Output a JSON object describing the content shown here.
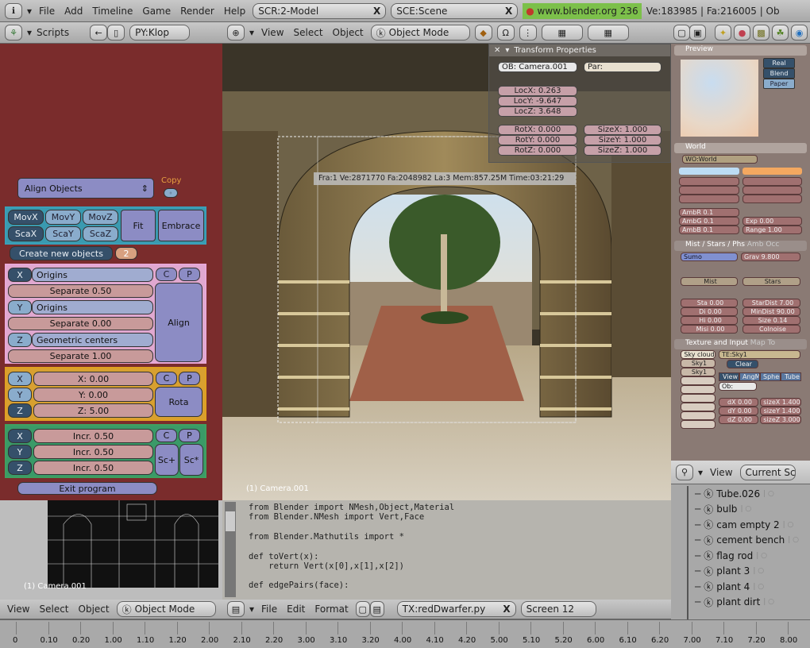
{
  "top_bar": {
    "menus": [
      "File",
      "Add",
      "Timeline",
      "Game",
      "Render",
      "Help"
    ],
    "screen_selector": "SCR:2-Model",
    "scene_selector": "SCE:Scene",
    "version_link": "www.blender.org 236",
    "stats": "Ve:183985 | Fa:216005 | Ob"
  },
  "scripts_header": {
    "label": "Scripts",
    "script_selector": "PY:Klop"
  },
  "view3d_header": {
    "menus": [
      "View",
      "Select",
      "Object"
    ],
    "mode": "Object Mode"
  },
  "script_panel": {
    "title_select": "Align Objects",
    "copy_label": "Copy",
    "move_buttons": [
      "MovX",
      "MovY",
      "MovZ"
    ],
    "scale_buttons": [
      "ScaX",
      "ScaY",
      "ScaZ"
    ],
    "fit": "Fit",
    "embrace": "Embrace",
    "create_new": "Create new objects",
    "create_count": "2",
    "align_rows": [
      {
        "axis": "X",
        "mode": "Origins",
        "separate": "Separate 0.50"
      },
      {
        "axis": "Y",
        "mode": "Origins",
        "separate": "Separate 0.00"
      },
      {
        "axis": "Z",
        "mode": "Geometric centers",
        "separate": "Separate 1.00"
      }
    ],
    "align_button": "Align",
    "rot_rows": [
      {
        "axis": "X",
        "value": "X: 0.00"
      },
      {
        "axis": "Y",
        "value": "Y: 0.00"
      },
      {
        "axis": "Z",
        "value": "Z: 5.00"
      }
    ],
    "rota_button": "Rota",
    "incr_rows": [
      {
        "axis": "X",
        "value": "Incr. 0.50"
      },
      {
        "axis": "Y",
        "value": "Incr. 0.50"
      },
      {
        "axis": "Z",
        "value": "Incr. 0.50"
      }
    ],
    "sc_plus": "Sc+",
    "sc_star": "Sc*",
    "c": "C",
    "p": "P",
    "exit": "Exit program"
  },
  "viewport": {
    "render_info": "Fra:1  Ve:2871770 Fa:2048982 La:3 Mem:857.25M Time:03:21:29",
    "camera_label": "(1) Camera.001",
    "transform": {
      "title": "Transform Properties",
      "object": "OB: Camera.001",
      "parent": "Par:",
      "loc": [
        "LocX: 0.263",
        "LocY: -9.647",
        "LocZ: 3.648"
      ],
      "rot": [
        "RotX: 0.000",
        "RotY: 0.000",
        "RotZ: 0.000"
      ],
      "size": [
        "SizeX: 1.000",
        "SizeY: 1.000",
        "SizeZ: 1.000"
      ]
    }
  },
  "buttons_window": {
    "preview_title": "Preview",
    "preview_types": [
      "Real",
      "Blend",
      "Paper"
    ],
    "world_title": "World",
    "world_name": "WO:World",
    "horizon_color": "#bcdcf4",
    "zenith_color": "#f4a860",
    "amb_fields": [
      "AmbR 0.1",
      "AmbG 0.1",
      "AmbB 0.1"
    ],
    "exp_fields": [
      "Exp 0.00",
      "Range 1.00"
    ],
    "mist_tab": "Mist / Stars / Phs",
    "amb_occ_tab": "Amb Occ",
    "physics": "Sumo",
    "grav": "Grav 9.800",
    "mist": "Mist",
    "stars": "Stars",
    "mist_fields": [
      "Sta 0.00",
      "Di 0.00",
      "Hi 0.00",
      "Misi 0.00"
    ],
    "star_fields": [
      "StarDist 7.00",
      "MinDist 90.00",
      "Size 0.14",
      "Colnoise"
    ],
    "texture_tab": "Texture and Input",
    "map_to_tab": "Map To",
    "tex_channels": [
      "Sky cloud",
      "Sky1",
      "Sky1"
    ],
    "tex_name": "TE:Sky1",
    "clear": "Clear",
    "mapping": [
      "View",
      "AngMap",
      "Sphere",
      "Tube"
    ],
    "object_field": "Ob:",
    "offset": [
      "dX 0.00",
      "dY 0.00",
      "dZ 0.00"
    ],
    "size": [
      "sizeX 1.400",
      "sizeY 1.400",
      "sizeZ 3.000"
    ]
  },
  "outliner": {
    "view_menu": "View",
    "display_select": "Current Sc",
    "items": [
      "Tube.026",
      "bulb",
      "cam empty 2",
      "cement bench",
      "flag rod",
      "plant 3",
      "plant 4",
      "plant dirt"
    ]
  },
  "mini_view": {
    "camera_label": "(1) Camera.001",
    "menus": [
      "View",
      "Select",
      "Object"
    ],
    "mode": "Object Mode"
  },
  "text_editor": {
    "code_lines": [
      "from Blender import NMesh,Object,Material",
      "from Blender.NMesh import Vert,Face",
      "",
      "from Blender.Mathutils import *",
      "",
      "",
      "def toVert(x):",
      "    return Vert(x[0],x[1],x[2])",
      "",
      "def edgePairs(face):"
    ],
    "menus": [
      "File",
      "Edit",
      "Format"
    ],
    "text_name": "TX:redDwarfer.py",
    "screen": "Screen 12"
  },
  "timeline": {
    "ticks": [
      "0",
      "0.10",
      "0.20",
      "1.00",
      "1.10",
      "1.20",
      "2.00",
      "2.10",
      "2.20",
      "3.00",
      "3.10",
      "3.20",
      "4.00",
      "4.10",
      "4.20",
      "5.00",
      "5.10",
      "5.20",
      "6.00",
      "6.10",
      "6.20",
      "7.00",
      "7.10",
      "7.20",
      "8.00",
      "8.10"
    ]
  }
}
